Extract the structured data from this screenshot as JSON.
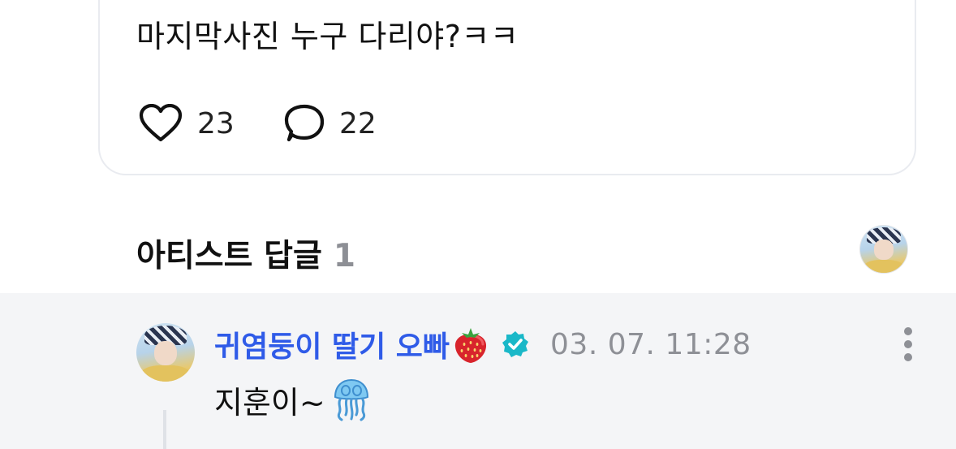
{
  "post": {
    "text": "마지막사진 누구 다리야?ㅋㅋ",
    "likes": "23",
    "comments": "22"
  },
  "artist_replies": {
    "title": "아티스트 답글",
    "count": "1"
  },
  "reply": {
    "author": "귀염둥이 딸기 오빠",
    "timestamp": "03. 07. 11:28",
    "text": "지훈이~"
  },
  "colors": {
    "author_name": "#2f5be8",
    "verified_badge": "#1ab8c8",
    "meta_text": "#8e9096",
    "reply_background": "#f4f5f7",
    "card_border": "#e9ebf0"
  },
  "icons": {
    "like": "heart-outline-icon",
    "comment": "speech-bubble-icon",
    "verified": "verified-check-icon",
    "more": "vertical-ellipsis-icon",
    "name_emoji": "strawberry-emoji",
    "reply_emoji": "jellyfish-emoji"
  }
}
